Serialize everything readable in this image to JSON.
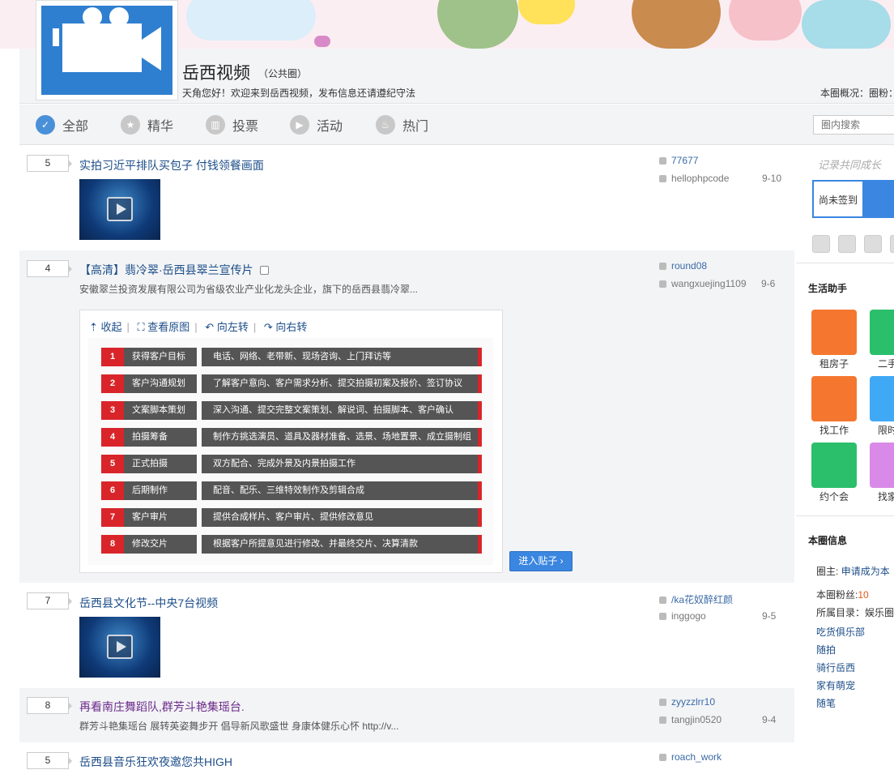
{
  "header": {
    "group_name": "岳西视频",
    "group_type": "（公共圈）",
    "welcome": "天角您好！欢迎来到岳西视频，发布信息还请遵纪守法",
    "overview": "本圈概况：圈粉："
  },
  "tabs": [
    {
      "label": "全部",
      "icon": "all-icon"
    },
    {
      "label": "精华",
      "icon": "star-icon"
    },
    {
      "label": "投票",
      "icon": "vote-icon"
    },
    {
      "label": "活动",
      "icon": "activity-icon"
    },
    {
      "label": "热门",
      "icon": "fire-icon"
    }
  ],
  "search": {
    "placeholder": "圈内搜索"
  },
  "posts": [
    {
      "count": "5",
      "title": "实拍习近平排队买包子 付钱领餐画面",
      "author": "77677",
      "replier": "hellophpcode",
      "date": "9-10"
    },
    {
      "count": "4",
      "title": "【高清】翡冷翠·岳西县翠兰宣传片",
      "desc": "安徽翠兰投资发展有限公司为省级农业产业化龙头企业，旗下的岳西县翡冷翠...",
      "author": "round08",
      "replier": "wangxuejing1109",
      "date": "9-6"
    },
    {
      "count": "7",
      "title": "岳西县文化节--中央7台视频",
      "author": "/ka花奴醉红颜",
      "replier": "inggogo",
      "date": "9-5"
    },
    {
      "count": "8",
      "title": "再看南庄舞蹈队,群芳斗艳集瑶台.",
      "desc": "群芳斗艳集瑶台 展转英姿舞步开 倡导新风歌盛世 身康体健乐心怀 http://v...",
      "author": "zyyzzlrr10",
      "replier": "tangjin0520",
      "date": "9-4"
    },
    {
      "count": "5",
      "title": "岳西县音乐狂欢夜邀您共HIGH",
      "author": "roach_work"
    }
  ],
  "viewer": {
    "collapse": "收起",
    "original": "查看原图",
    "rotate_left": "向左转",
    "rotate_right": "向右转",
    "enter_post": "进入贴子 ›",
    "steps": [
      {
        "num": "1",
        "label": "获得客户目标",
        "text": "电话、网络、老带新、现场咨询、上门拜访等"
      },
      {
        "num": "2",
        "label": "客户沟通规划",
        "text": "了解客户意向、客户需求分析、提交拍摄初案及报价、签订协议"
      },
      {
        "num": "3",
        "label": "文案脚本策划",
        "text": "深入沟通、提交完整文案策划、解说词、拍摄脚本、客户确认"
      },
      {
        "num": "4",
        "label": "拍摄筹备",
        "text": "制作方挑选演员、道具及器材准备、选景、场地置景、成立摄制组"
      },
      {
        "num": "5",
        "label": "正式拍摄",
        "text": "双方配合、完成外景及内景拍摄工作"
      },
      {
        "num": "6",
        "label": "后期制作",
        "text": "配音、配乐、三维特效制作及剪辑合成"
      },
      {
        "num": "7",
        "label": "客户审片",
        "text": "提供合成样片、客户审片、提供修改意见"
      },
      {
        "num": "8",
        "label": "修改交片",
        "text": "根据客户所提意见进行修改、并最终交片、决算清款"
      }
    ]
  },
  "sidebar": {
    "signature": "记录共同成长",
    "checkin": "尚未签到",
    "life_helper": "生活助手",
    "apps": [
      {
        "label": "租房子",
        "color": "#f5772f"
      },
      {
        "label": "二手",
        "color": "#2bbf6b"
      },
      {
        "label": "找工作",
        "color": "#f5772f"
      },
      {
        "label": "限时",
        "color": "#3fa9f5"
      },
      {
        "label": "约个会",
        "color": "#2bbf6b"
      },
      {
        "label": "找家",
        "color": "#d98ae8"
      }
    ],
    "info_title": "本圈信息",
    "owner_label": "圈主:",
    "owner_link": "申请成为本",
    "fans_label": "本圈粉丝:",
    "fans_value": "10",
    "catalog": "所属目录：娱乐圈",
    "links": [
      "吃货俱乐部",
      "随拍",
      "骑行岳西",
      "家有萌宠",
      "随笔"
    ]
  }
}
